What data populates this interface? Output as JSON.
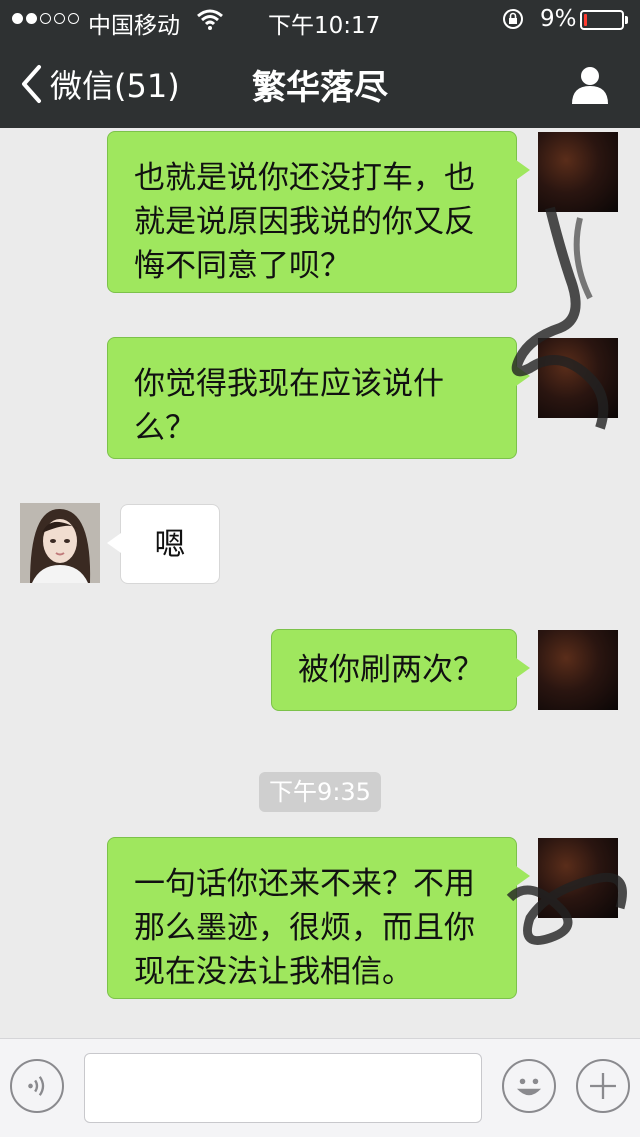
{
  "status_bar": {
    "carrier": "中国移动",
    "time": "下午10:17",
    "battery_percent": "9%",
    "battery_level": 0.09,
    "signal_bars_filled": 2,
    "signal_bars_total": 5,
    "icons": [
      "wifi-icon",
      "rotation-lock-icon",
      "battery-icon"
    ]
  },
  "nav": {
    "back_label": "微信(51)",
    "title": "繁华落尽",
    "icons": [
      "back-chevron-icon",
      "profile-icon"
    ]
  },
  "messages": [
    {
      "side": "sent",
      "text": "也就是说你还没打车，也就是说原因我说的你又反悔不同意了呗？"
    },
    {
      "side": "sent",
      "text": "你觉得我现在应该说什么？"
    },
    {
      "side": "received",
      "text": "嗯"
    },
    {
      "side": "sent",
      "text": "被你刷两次？"
    },
    {
      "side": "sent",
      "text": "一句话你还来不来？不用那么墨迹，很烦，而且你现在没法让我相信。"
    }
  ],
  "timestamp": "下午9:35",
  "input_bar": {
    "placeholder": "",
    "icons": [
      "voice-icon",
      "emoji-icon",
      "plus-icon"
    ]
  },
  "colors": {
    "bar_bg": "#2e3132",
    "chat_bg": "#ebebeb",
    "sent_bubble": "#9fe75e",
    "received_bubble": "#ffffff",
    "battery_low": "#ff3b30"
  }
}
